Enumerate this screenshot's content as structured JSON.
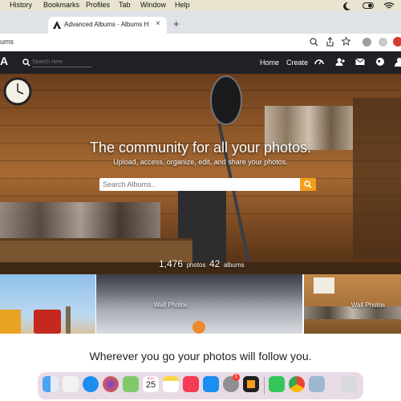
{
  "menubar": {
    "items": [
      "History",
      "Bookmarks",
      "Profiles",
      "Tab",
      "Window",
      "Help"
    ]
  },
  "browser": {
    "tab_title": "Advanced Albums - Albums H",
    "address_text": "ums",
    "new_tab": "+",
    "close_tab": "×"
  },
  "site": {
    "logo": "A",
    "search_placeholder": "Search here",
    "nav": {
      "home": "Home",
      "create": "Create"
    }
  },
  "hero": {
    "headline": "The community for all your photos.",
    "subheadline": "Upload, access, organize, edit, and share your photos.",
    "search_placeholder": "Search Albums..",
    "stats": {
      "photos_count": "1,476",
      "photos_label": "photos",
      "albums_count": "42",
      "albums_label": "albums"
    }
  },
  "tiles": [
    {
      "label": ""
    },
    {
      "label": "Wall Photos"
    },
    {
      "label": "Wall Photos"
    }
  ],
  "tagline": "Wherever you go your photos will follow you.",
  "dock": {
    "calendar_month": "AUG",
    "calendar_day": "25",
    "badge": "1"
  },
  "colors": {
    "accent": "#f0a11c",
    "nav_bg": "#1f2125",
    "menubar_bg": "#e9e4cf"
  }
}
